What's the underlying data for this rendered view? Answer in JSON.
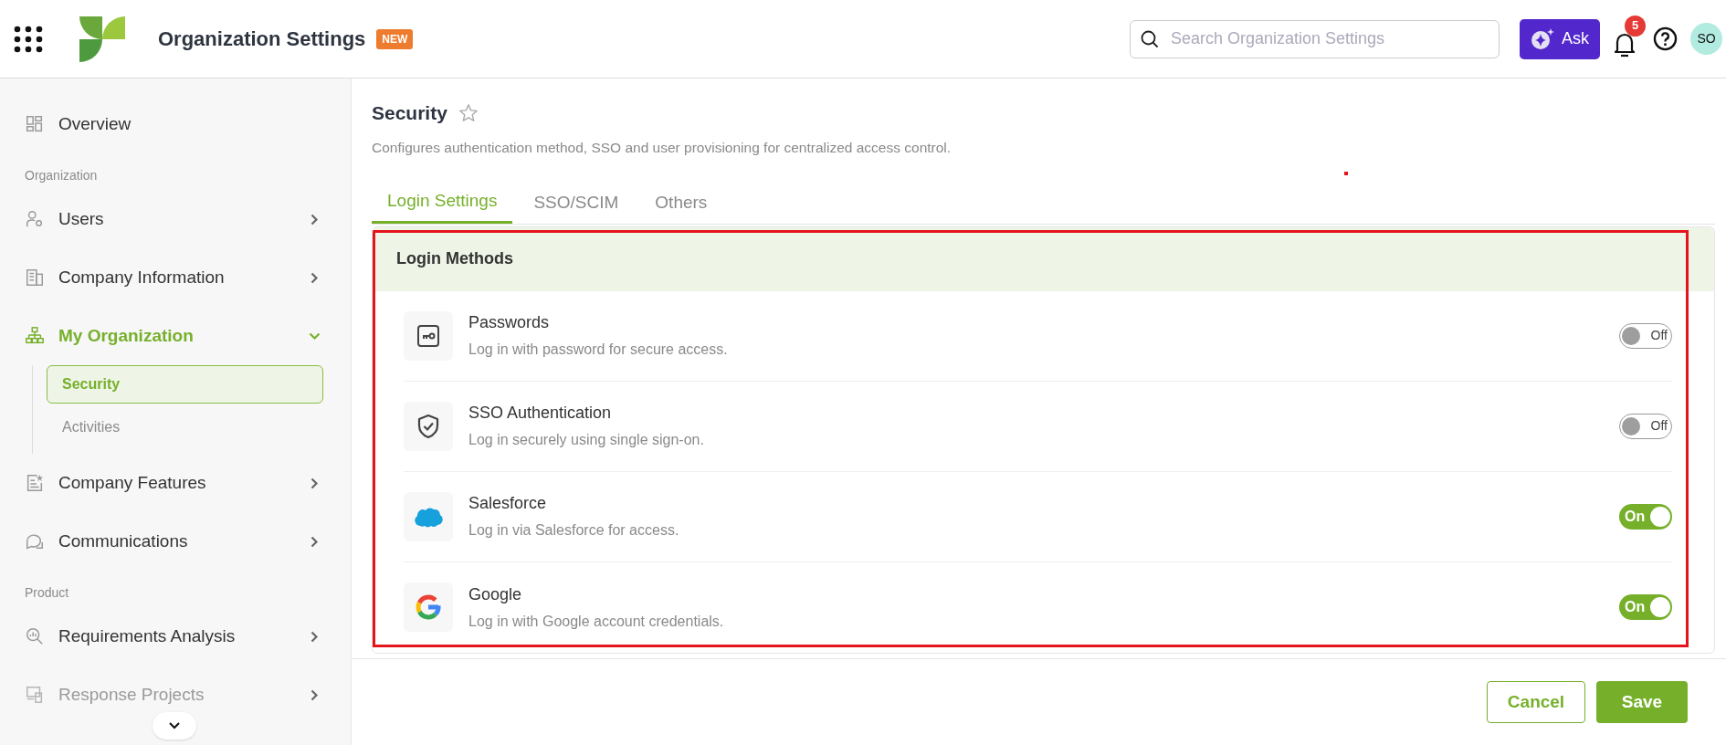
{
  "header": {
    "title": "Organization Settings",
    "badge": "NEW",
    "search": {
      "placeholder": "Search Organization Settings"
    },
    "ask_button": "Ask",
    "notifications": "5",
    "avatar": "SO"
  },
  "sidebar": {
    "items": [
      {
        "kind": "link",
        "label": "Overview",
        "selected": false,
        "dimmed": false
      },
      {
        "kind": "section",
        "label": "Organization"
      },
      {
        "kind": "group",
        "label": "Users",
        "expanded": false,
        "selected": false,
        "dimmed": false
      },
      {
        "kind": "group",
        "label": "Company Information",
        "expanded": false,
        "selected": false,
        "dimmed": false
      },
      {
        "kind": "group",
        "label": "My Organization",
        "expanded": true,
        "selected": true,
        "dimmed": false,
        "children": [
          {
            "label": "Security",
            "selected": true
          },
          {
            "label": "Activities",
            "selected": false
          }
        ]
      },
      {
        "kind": "group",
        "label": "Company Features",
        "expanded": false,
        "selected": false,
        "dimmed": false
      },
      {
        "kind": "group",
        "label": "Communications",
        "expanded": false,
        "selected": false,
        "dimmed": false
      },
      {
        "kind": "section",
        "label": "Product"
      },
      {
        "kind": "group",
        "label": "Requirements Analysis",
        "expanded": false,
        "selected": false,
        "dimmed": false
      },
      {
        "kind": "group",
        "label": "Response Projects",
        "expanded": false,
        "selected": false,
        "dimmed": true
      }
    ]
  },
  "page": {
    "title": "Security",
    "favorite": false,
    "description": "Configures authentication method, SSO and user provisioning for centralized access control.",
    "tabs": [
      {
        "label": "Login Settings",
        "selected": true
      },
      {
        "label": "SSO/SCIM",
        "selected": false
      },
      {
        "label": "Others",
        "selected": false
      }
    ],
    "card": {
      "title": "Login Methods",
      "methods": [
        {
          "name": "Passwords",
          "description": "Log in with password for secure access.",
          "on": false,
          "toggle_label": "Off"
        },
        {
          "name": "SSO Authentication",
          "description": "Log in securely using single sign-on.",
          "on": false,
          "toggle_label": "Off"
        },
        {
          "name": "Salesforce",
          "description": "Log in via Salesforce for access.",
          "on": true,
          "toggle_label": "On"
        },
        {
          "name": "Google",
          "description": "Log in with Google account credentials.",
          "on": true,
          "toggle_label": "On"
        }
      ]
    }
  },
  "footer": {
    "buttons": [
      {
        "kind": "secondary",
        "label": "Cancel"
      },
      {
        "kind": "primary",
        "label": "Save"
      }
    ]
  }
}
